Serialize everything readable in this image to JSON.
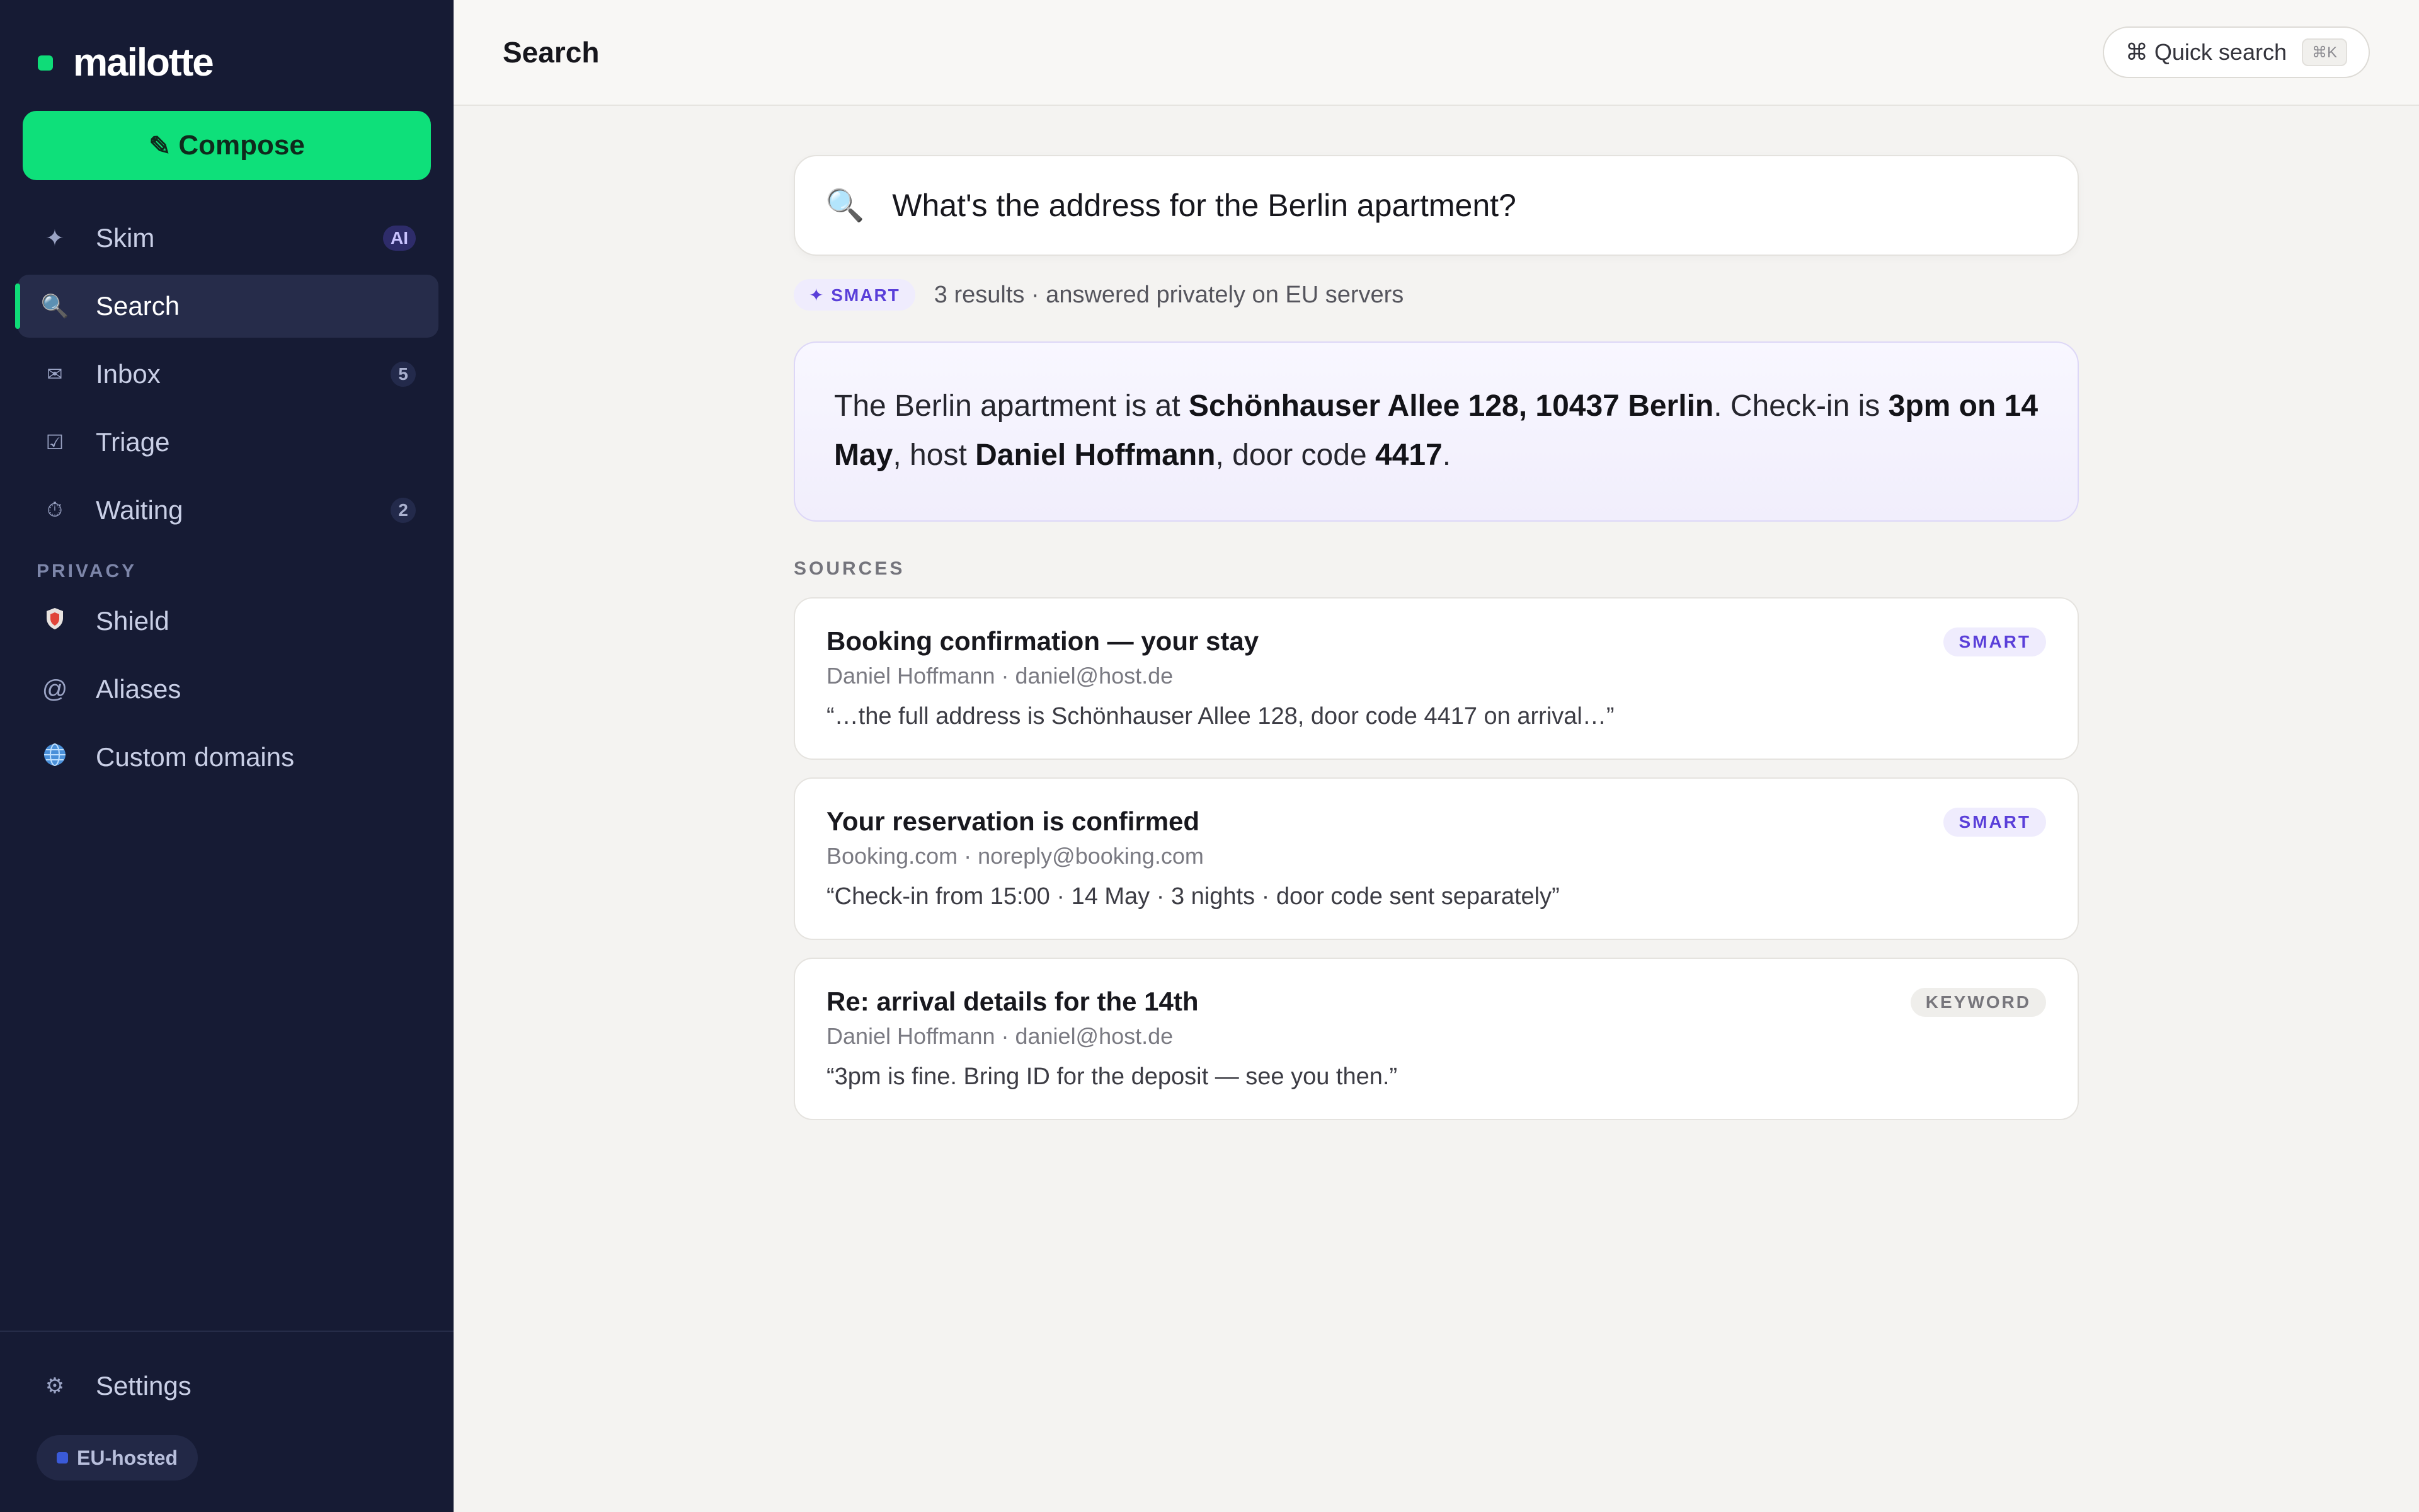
{
  "brand": {
    "name": "mailotte",
    "accent": "#0fdc78"
  },
  "sidebar": {
    "compose_label": "Compose",
    "items": [
      {
        "label": "Skim",
        "icon": "sparkle-icon",
        "badge": "AI"
      },
      {
        "label": "Search",
        "icon": "search-icon",
        "active": true
      },
      {
        "label": "Inbox",
        "icon": "envelope-icon",
        "badge": "5"
      },
      {
        "label": "Triage",
        "icon": "checkbox-icon"
      },
      {
        "label": "Waiting",
        "icon": "stopwatch-icon",
        "badge": "2"
      }
    ],
    "privacy_label": "PRIVACY",
    "privacy_items": [
      {
        "label": "Shield",
        "icon": "shield-icon"
      },
      {
        "label": "Aliases",
        "icon": "at-icon"
      },
      {
        "label": "Custom domains",
        "icon": "globe-icon"
      }
    ],
    "settings_label": "Settings",
    "eu_label": "EU-hosted"
  },
  "topbar": {
    "title": "Search",
    "quick_search_label": "⌘ Quick search",
    "quick_search_kbd": "⌘K"
  },
  "search": {
    "query": "What's the address for the Berlin apartment?",
    "mode": "✦ SMART",
    "meta": "3 results · answered privately on EU servers"
  },
  "answer": {
    "p1": "The Berlin apartment is at ",
    "address": "Schönhauser Allee 128, 10437 Berlin",
    "p2": ". Check-in is ",
    "checkin": "3pm on 14 May",
    "p3": ", host ",
    "host": "Daniel Hoffmann",
    "p4": ", door code ",
    "code": "4417",
    "p5": "."
  },
  "sources": {
    "label": "SOURCES",
    "items": [
      {
        "title": "Booking confirmation — your stay",
        "from": "Daniel Hoffmann · daniel@host.de",
        "snippet": "“…the full address is Schönhauser Allee 128, door code 4417 on arrival…”",
        "tag": "SMART"
      },
      {
        "title": "Your reservation is confirmed",
        "from": "Booking.com · noreply@booking.com",
        "snippet": "“Check-in from 15:00 · 14 May · 3 nights · door code sent separately”",
        "tag": "SMART"
      },
      {
        "title": "Re: arrival details for the 14th",
        "from": "Daniel Hoffmann · daniel@host.de",
        "snippet": "“3pm is fine. Bring ID for the deposit — see you then.”",
        "tag": "KEYWORD"
      }
    ]
  }
}
